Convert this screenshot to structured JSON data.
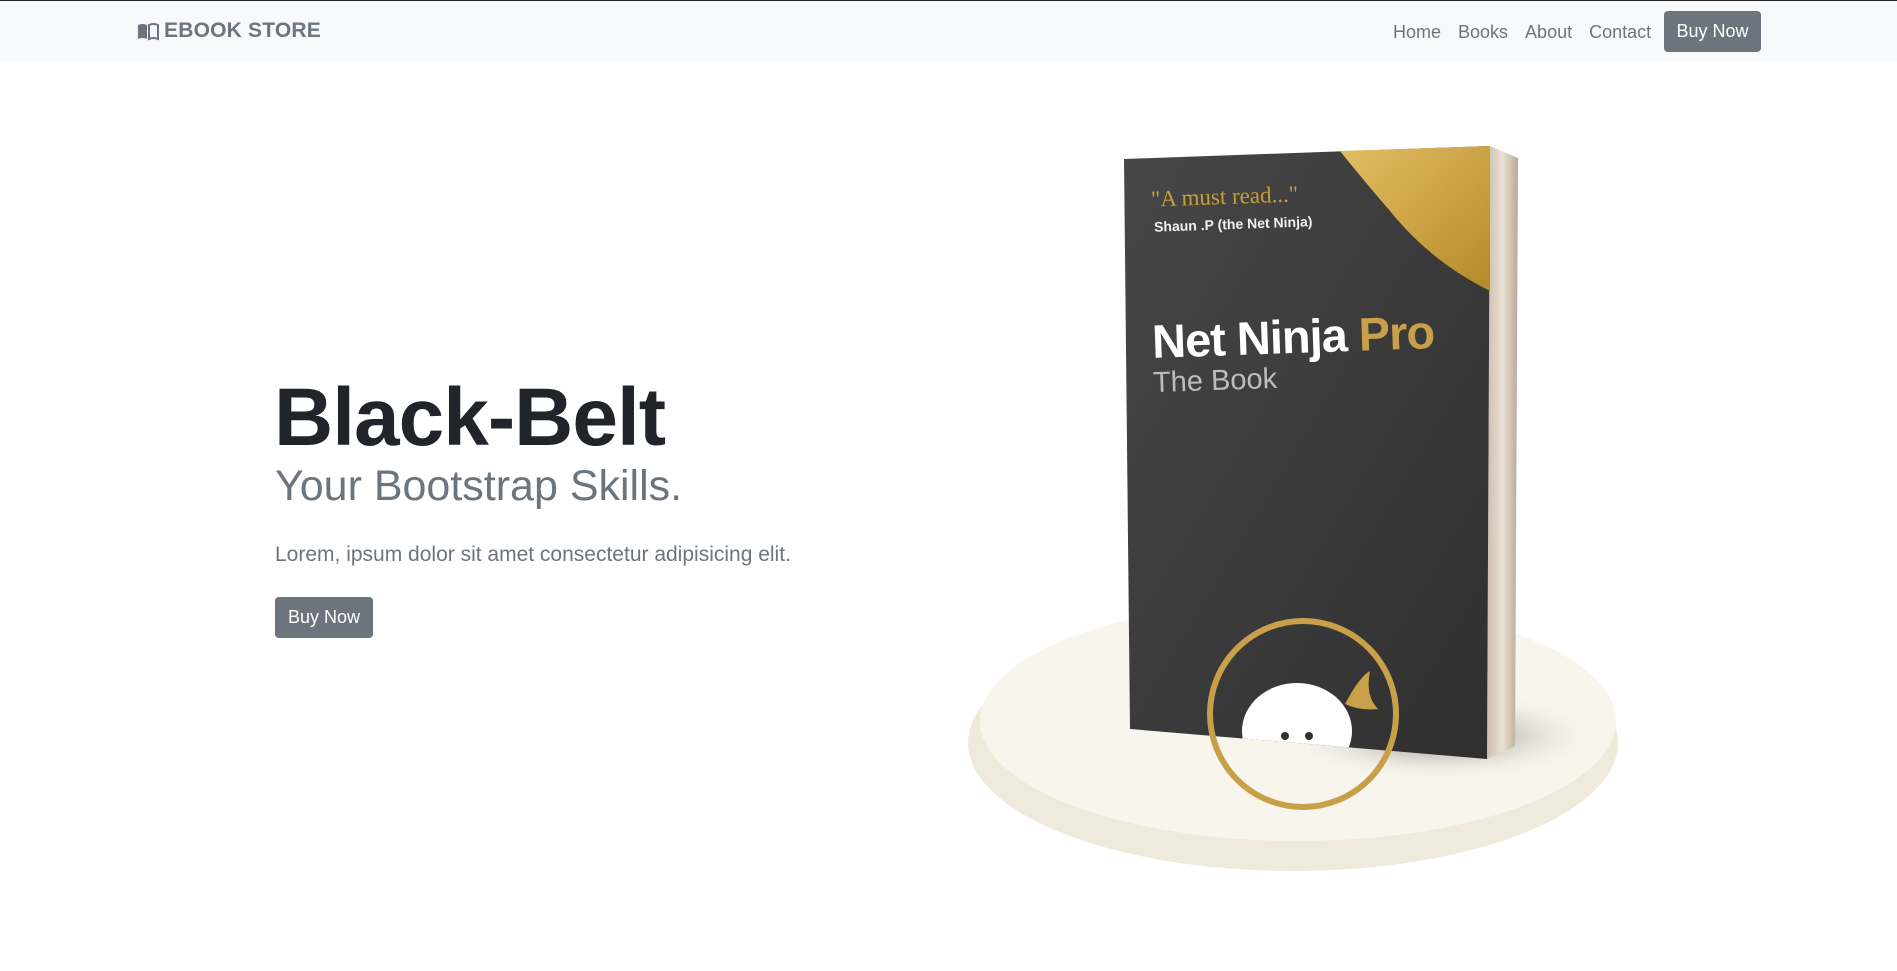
{
  "navbar": {
    "brand": "EBOOK STORE",
    "brand_icon": "open-book-icon",
    "links": [
      "Home",
      "Books",
      "About",
      "Contact"
    ],
    "buy_label": "Buy Now"
  },
  "hero": {
    "title": "Black-Belt",
    "subtitle": "Your Bootstrap Skills.",
    "lead": "Lorem, ipsum dolor sit amet consectetur adipisicing elit.",
    "buy_label": "Buy Now"
  },
  "book": {
    "quote": "\"A must read...\"",
    "quote_author": "Shaun .P (the Net Ninja)",
    "title_main": "Net Ninja",
    "title_pro": "Pro",
    "subtitle": "The Book",
    "logo_icon": "ninja-logo-icon"
  },
  "colors": {
    "accent_gold": "#c9a04a",
    "button_gray": "#6c757d",
    "navbar_bg": "#f8f9fa",
    "cover_dark": "#3c3c3c",
    "pedestal": "#f7f4ea"
  }
}
